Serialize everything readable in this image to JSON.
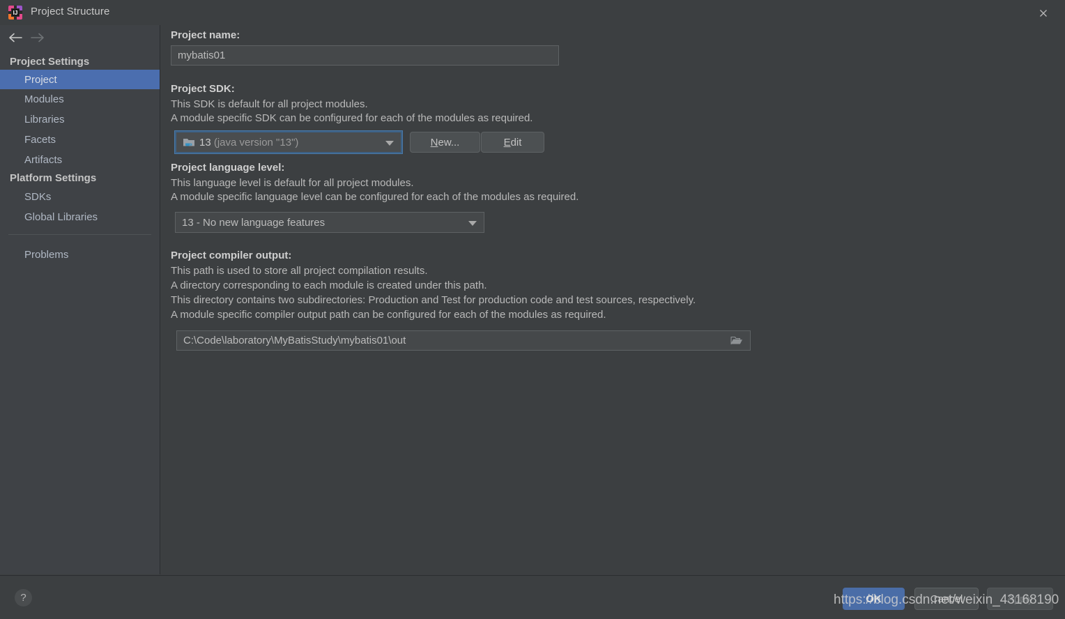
{
  "window": {
    "title": "Project Structure",
    "app_icon": "intellij-idea-icon",
    "close_icon": "close-icon"
  },
  "nav": {
    "back_icon": "arrow-left-icon",
    "forward_icon": "arrow-right-icon"
  },
  "sidebar": {
    "groups": [
      {
        "label": "Project Settings"
      },
      {
        "label": "Platform Settings"
      }
    ],
    "items": [
      {
        "label": "Project",
        "selected": true
      },
      {
        "label": "Modules",
        "selected": false
      },
      {
        "label": "Libraries",
        "selected": false
      },
      {
        "label": "Facets",
        "selected": false
      },
      {
        "label": "Artifacts",
        "selected": false
      },
      {
        "label": "SDKs",
        "selected": false
      },
      {
        "label": "Global Libraries",
        "selected": false
      },
      {
        "label": "Problems",
        "selected": false
      }
    ],
    "selection_color": "#4b6eaf"
  },
  "main": {
    "project_name": {
      "label": "Project name:",
      "value": "mybatis01"
    },
    "project_sdk": {
      "label": "Project SDK:",
      "desc_line1": "This SDK is default for all project modules.",
      "desc_line2": "A module specific SDK can be configured for each of the modules as required.",
      "selected_version": "13",
      "selected_detail": "(java version \"13\")",
      "icon": "java-sdk-folder-icon",
      "dropdown_icon": "chevron-down-icon",
      "new_button": "New...",
      "new_button_mnemonic": "N",
      "edit_button": "Edit",
      "edit_button_mnemonic": "E"
    },
    "language_level": {
      "label": "Project language level:",
      "desc_line1": "This language level is default for all project modules.",
      "desc_line2": "A module specific language level can be configured for each of the modules as required.",
      "selected": "13 - No new language features",
      "dropdown_icon": "chevron-down-icon"
    },
    "compiler_output": {
      "label": "Project compiler output:",
      "desc_line1": "This path is used to store all project compilation results.",
      "desc_line2": "A directory corresponding to each module is created under this path.",
      "desc_line3": "This directory contains two subdirectories: Production and Test for production code and test sources, respectively.",
      "desc_line4": "A module specific compiler output path can be configured for each of the modules as required.",
      "value": "C:\\Code\\laboratory\\MyBatisStudy\\mybatis01\\out",
      "browse_icon": "folder-open-icon"
    }
  },
  "footer": {
    "help_label": "?",
    "ok_label": "OK",
    "cancel_label": "Cancel",
    "apply_label": "Apply",
    "ok_color": "#4a6da7"
  },
  "watermark": {
    "text": "https://blog.csdn.net/weixin_43168190"
  }
}
